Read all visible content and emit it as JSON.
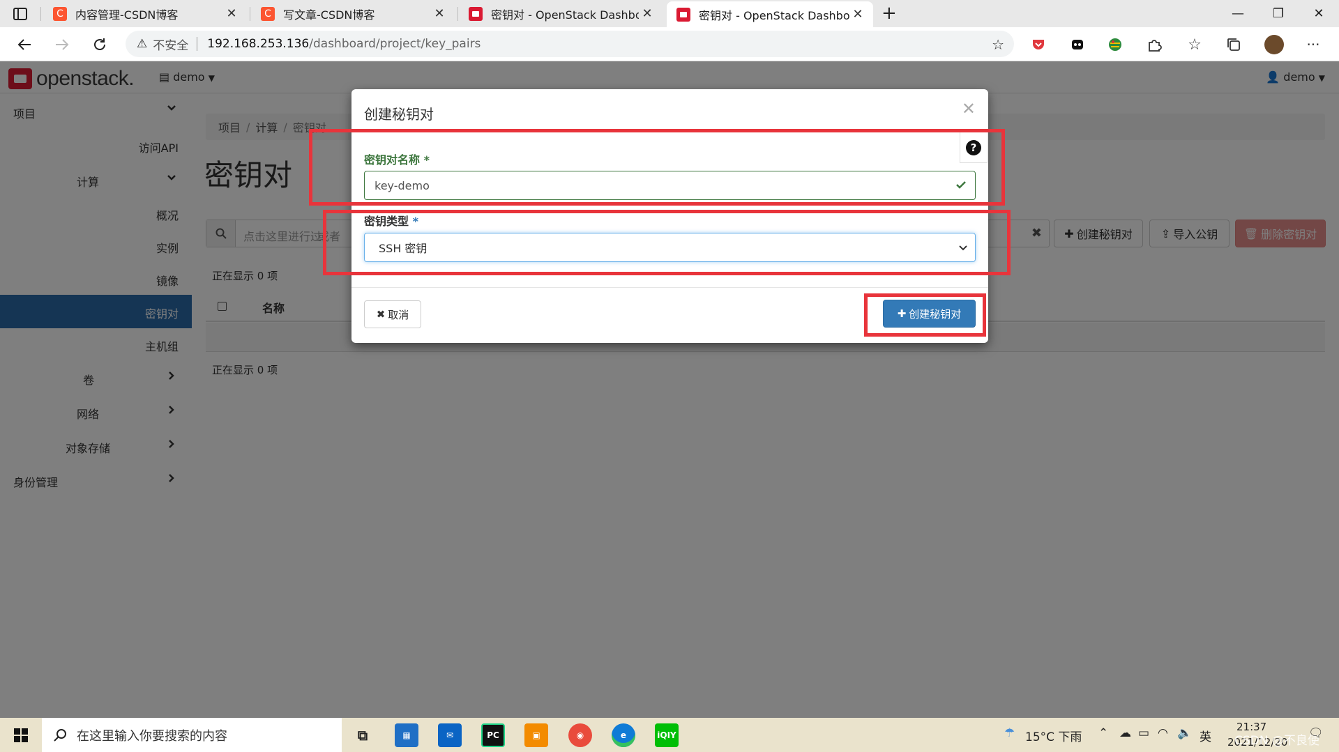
{
  "browser": {
    "tabs": [
      {
        "title": "内容管理-CSDN博客",
        "favicon_color": "#fc5531",
        "favicon_letter": "C"
      },
      {
        "title": "写文章-CSDN博客",
        "favicon_color": "#fc5531",
        "favicon_letter": "C"
      },
      {
        "title": "密钥对 - OpenStack Dashboard",
        "favicon_color": "#da1a32",
        "favicon_letter": ""
      },
      {
        "title": "密钥对 - OpenStack Dashboard",
        "favicon_color": "#da1a32",
        "favicon_letter": ""
      }
    ],
    "new_tab": "+",
    "address": {
      "security_label": "不安全",
      "host": "192.168.253.136",
      "path": "/dashboard/project/key_pairs"
    }
  },
  "header": {
    "logo": "openstack.",
    "project": "demo",
    "user": "demo"
  },
  "sidebar": {
    "items": [
      {
        "label": "项目"
      },
      {
        "label": "访问API"
      },
      {
        "label": "计算"
      },
      {
        "label": "概况"
      },
      {
        "label": "实例"
      },
      {
        "label": "镜像"
      },
      {
        "label": "密钥对"
      },
      {
        "label": "主机组"
      },
      {
        "label": "卷"
      },
      {
        "label": "网络"
      },
      {
        "label": "对象存储"
      },
      {
        "label": "身份管理"
      }
    ]
  },
  "main": {
    "breadcrumb": [
      "项目",
      "计算",
      "密钥对"
    ],
    "breadcrumb_sep": "/",
    "title": "密钥对",
    "filter_placeholder": "点击这里进行过滤或者全文搜索",
    "filter_visible": "点击这里进行过",
    "filter_tail": "或者",
    "buttons": {
      "create": "创建秘钥对",
      "import": "导入公钥",
      "delete": "删除密钥对"
    },
    "showing": "正在显示 0 项",
    "table": {
      "columns": [
        "名称"
      ]
    }
  },
  "modal": {
    "title": "创建秘钥对",
    "name_label": "密钥对名称",
    "name_value": "key-demo",
    "type_label": "密钥类型",
    "required_mark": "*",
    "type_value": "SSH 密钥",
    "cancel": "取消",
    "submit": "创建秘钥对",
    "colors": {
      "primary": "#337ab7",
      "success": "#3c763d",
      "highlight": "#e8343b"
    }
  },
  "taskbar": {
    "search_placeholder": "在这里输入你要搜索的内容",
    "weather": "15°C 下雨",
    "ime": "英",
    "time": "21:37",
    "date": "2021/12/20",
    "watermark": "CSDN @不良使"
  }
}
